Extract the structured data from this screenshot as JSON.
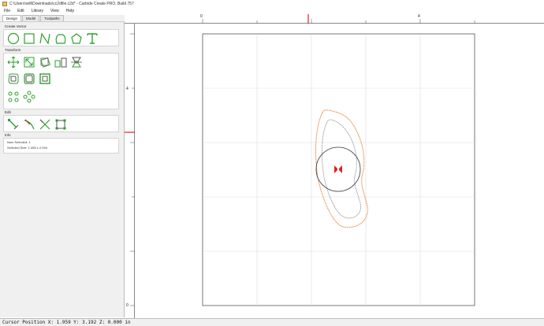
{
  "window": {
    "title": "C:\\Users\\will\\Downloads\\cc2dfile.c2d* - Carbide Create PRO, Build 757"
  },
  "menu": [
    "File",
    "Edit",
    "Library",
    "View",
    "Help"
  ],
  "tabs": [
    {
      "label": "Design",
      "active": true
    },
    {
      "label": "Model",
      "active": false
    },
    {
      "label": "Toolpaths",
      "active": false
    }
  ],
  "panel": {
    "create_vector": {
      "title": "Create Vector",
      "tools": [
        "circle-icon",
        "rectangle-icon",
        "polyline-icon",
        "curve-icon",
        "polygon-icon",
        "text-icon"
      ]
    },
    "transform": {
      "title": "Transform",
      "tools": [
        "move-icon",
        "scale-icon",
        "rotate-icon",
        "mirror-icon",
        "align-icon",
        "offset-icon",
        "boolean-icon",
        "join-icon",
        "array-icon",
        "circular-array-icon"
      ]
    },
    "edit": {
      "title": "Edit",
      "tools": [
        "node-edit-icon",
        "knife-icon",
        "trim-icon",
        "bounding-box-icon"
      ]
    },
    "info": {
      "title": "Info",
      "num_selected": "Num Selected:  1",
      "selected_size": "Selected Size:   1.065 x 2.094"
    }
  },
  "rulers": {
    "top_labels": [
      "0",
      "4"
    ],
    "left_labels": [
      "4",
      "0"
    ]
  },
  "colors": {
    "green_tool": "#2ea02e",
    "orange_path": "#e8843c",
    "selection_red": "#e02020",
    "gray_path": "#8a8a8a"
  },
  "status": {
    "text": "Cursor Position X: 1.959 Y: 3.192 Z: 0.000 in"
  }
}
